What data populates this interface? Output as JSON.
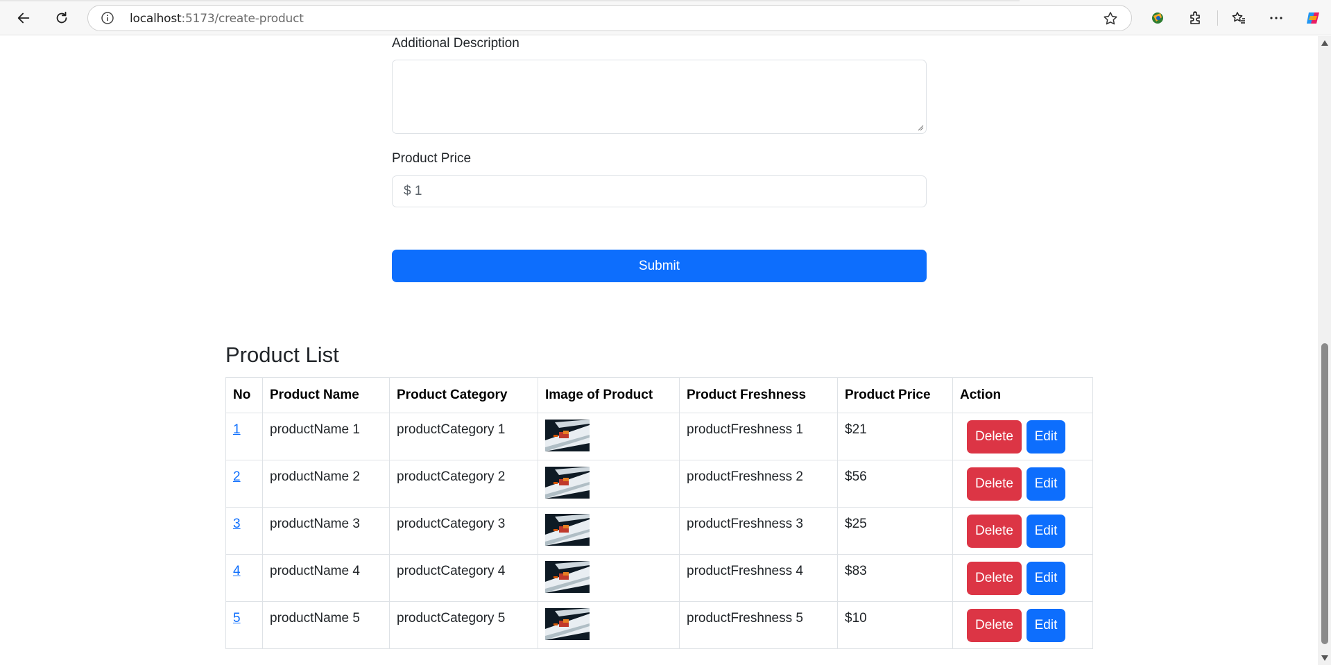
{
  "browser": {
    "url_host": "localhost",
    "url_path": ":5173/create-product",
    "icons": [
      "back-arrow-icon",
      "reload-icon",
      "info-icon",
      "star-icon",
      "extension-colorful-icon",
      "puzzle-icon",
      "favorites-icon",
      "more-icon",
      "copilot-icon"
    ]
  },
  "form": {
    "description_label": "Additional Description",
    "description_value": "",
    "price_label": "Product Price",
    "price_value": "$ 1",
    "submit_label": "Submit"
  },
  "product_list": {
    "title": "Product List",
    "columns": [
      "No",
      "Product Name",
      "Product Category",
      "Image of Product",
      "Product Freshness",
      "Product Price",
      "Action"
    ],
    "rows": [
      {
        "no": "1",
        "name": "productName 1",
        "category": "productCategory 1",
        "freshness": "productFreshness 1",
        "price": "$21"
      },
      {
        "no": "2",
        "name": "productName 2",
        "category": "productCategory 2",
        "freshness": "productFreshness 2",
        "price": "$56"
      },
      {
        "no": "3",
        "name": "productName 3",
        "category": "productCategory 3",
        "freshness": "productFreshness 3",
        "price": "$25"
      },
      {
        "no": "4",
        "name": "productName 4",
        "category": "productCategory 4",
        "freshness": "productFreshness 4",
        "price": "$83"
      },
      {
        "no": "5",
        "name": "productName 5",
        "category": "productCategory 5",
        "freshness": "productFreshness 5",
        "price": "$10"
      }
    ],
    "delete_label": "Delete",
    "edit_label": "Edit"
  },
  "colors": {
    "primary": "#0d6efd",
    "danger": "#dc3545",
    "border": "#dee2e6"
  }
}
